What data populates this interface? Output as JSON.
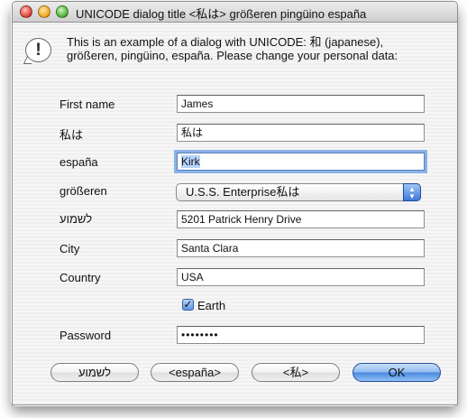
{
  "window": {
    "title": "UNICODE dialog title <私は> größeren  pingüino  españa"
  },
  "message": "This is an example of a dialog with UNICODE: 和  (japanese), größeren,  pingüino,   españa. Please change your personal data:",
  "form": {
    "first_name": {
      "label": "First name",
      "value": "James"
    },
    "watashi": {
      "label": "私は",
      "value": "私は"
    },
    "espana": {
      "label": "españa",
      "value": "Kirk"
    },
    "grosseren": {
      "label": "größeren",
      "selected": "U.S.S. Enterprise私は"
    },
    "hebrew": {
      "label": "לשמוע",
      "value": "5201 Patrick Henry Drive"
    },
    "city": {
      "label": "City",
      "value": "Santa Clara"
    },
    "country": {
      "label": "Country",
      "value": "USA"
    },
    "earth": {
      "label": "Earth",
      "checked": true
    },
    "password": {
      "label": "Password",
      "value": "••••••••"
    }
  },
  "buttons": {
    "hebrew": "לשמוע",
    "espana": "<españa>",
    "watashi": "<私>",
    "ok": "OK"
  },
  "colors": {
    "accent": "#4a88df",
    "focus_ring": "#8ab2e6",
    "selection": "#b5d3ff"
  },
  "icons": {
    "alert": "exclamation-alert-icon",
    "popup": "up-down-arrows-icon",
    "check": "checkmark-icon"
  }
}
